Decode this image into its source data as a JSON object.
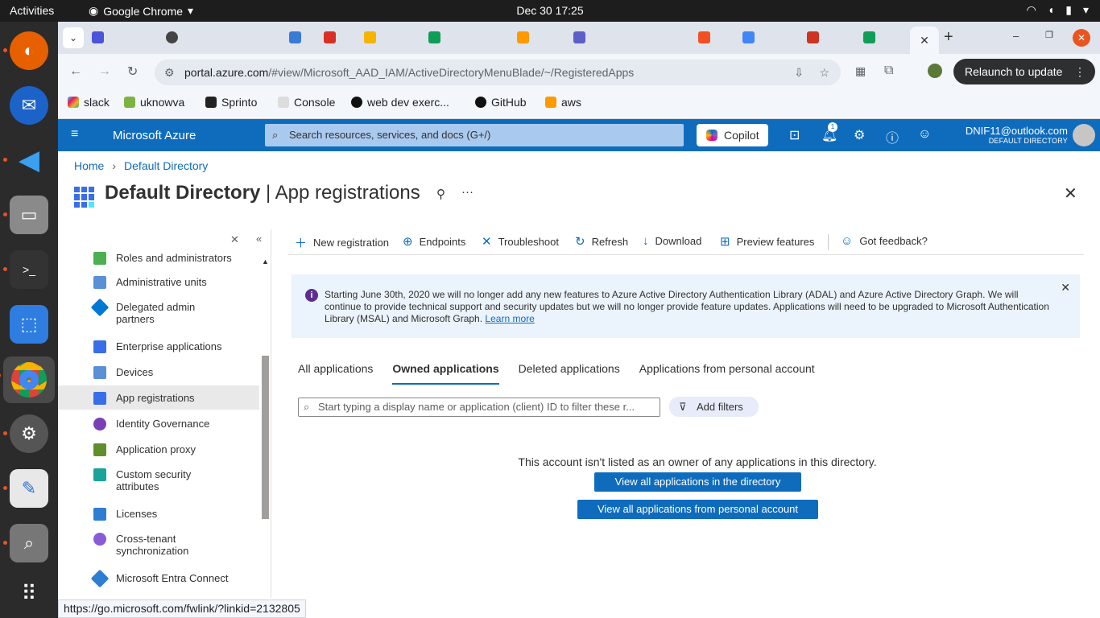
{
  "system": {
    "activities": "Activities",
    "app_name": "Google Chrome",
    "clock": "Dec 30  17:25"
  },
  "browser": {
    "url_host": "portal.azure.com",
    "url_path": "/#view/Microsoft_AAD_IAM/ActiveDirectoryMenuBlade/~/RegisteredApps",
    "relaunch": "Relaunch to update",
    "bookmarks": [
      "slack",
      "uknowva",
      "Sprinto",
      "Console",
      "web dev exerc...",
      "GitHub",
      "aws"
    ],
    "status_url": "https://go.microsoft.com/fwlink/?linkid=2132805"
  },
  "azure": {
    "brand": "Microsoft Azure",
    "search_placeholder": "Search resources, services, and docs (G+/)",
    "copilot": "Copilot",
    "notif_count": "1",
    "account_email": "DNIF11@outlook.com",
    "account_dir": "DEFAULT DIRECTORY"
  },
  "breadcrumb": {
    "home": "Home",
    "dir": "Default Directory"
  },
  "title": {
    "bold": "Default Directory",
    "rest": " | App registrations"
  },
  "sidebar": {
    "items": [
      {
        "label": "Roles and administrators",
        "color": "#4caf50"
      },
      {
        "label": "Administrative units",
        "color": "#5b8fd6"
      },
      {
        "label": "Delegated admin partners",
        "color": "#0078d4"
      },
      {
        "label": "Enterprise applications",
        "color": "#3a6ee8"
      },
      {
        "label": "Devices",
        "color": "#5b8fd6"
      },
      {
        "label": "App registrations",
        "color": "#3a6ee8"
      },
      {
        "label": "Identity Governance",
        "color": "#7b3fb5"
      },
      {
        "label": "Application proxy",
        "color": "#5f8f2b"
      },
      {
        "label": "Custom security attributes",
        "color": "#1aa39a"
      },
      {
        "label": "Licenses",
        "color": "#2d7dd2"
      },
      {
        "label": "Cross-tenant synchronization",
        "color": "#8a5bd6"
      },
      {
        "label": "Microsoft Entra Connect",
        "color": "#2d7dd2"
      }
    ]
  },
  "commands": {
    "new_registration": "New registration",
    "endpoints": "Endpoints",
    "troubleshoot": "Troubleshoot",
    "refresh": "Refresh",
    "download": "Download",
    "preview": "Preview features",
    "feedback": "Got feedback?"
  },
  "banner": {
    "text": "Starting June 30th, 2020 we will no longer add any new features to Azure Active Directory Authentication Library (ADAL) and Azure Active Directory Graph. We will continue to provide technical support and security updates but we will no longer provide feature updates. Applications will need to be upgraded to Microsoft Authentication Library (MSAL) and Microsoft Graph.",
    "link": "Learn more"
  },
  "tabs": [
    "All applications",
    "Owned applications",
    "Deleted applications",
    "Applications from personal account"
  ],
  "filter_placeholder": "Start typing a display name or application (client) ID to filter these r...",
  "add_filters": "Add filters",
  "empty": {
    "message": "This account isn't listed as an owner of any applications in this directory.",
    "btn_directory": "View all applications in the directory",
    "btn_personal": "View all applications from personal account"
  }
}
